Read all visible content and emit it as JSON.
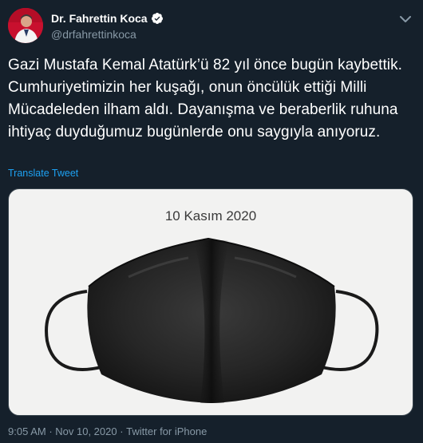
{
  "user": {
    "name": "Dr. Fahrettin Koca",
    "handle": "@drfahrettinkoca"
  },
  "tweet": {
    "text": "Gazi Mustafa Kemal Atatürk’ü 82 yıl önce bugün kaybettik. Cumhuriyetimizin her kuşağı, onun öncülük ettiği Milli Mücadeleden ilham aldı. Dayanışma ve beraberlik ruhuna ihtiyaç duyduğumuz bugünlerde onu saygıyla anıyoruz.",
    "translate_label": "Translate Tweet",
    "image_caption": "10 Kasım 2020"
  },
  "meta": {
    "time": "9:05 AM",
    "separator": " · ",
    "date": "Nov 10, 2020",
    "source": "Twitter for iPhone"
  },
  "colors": {
    "background": "#15202b",
    "link": "#1da1f2",
    "secondary_text": "#8899a6",
    "verified": "#1da1f2"
  },
  "icons": [
    "verified-badge-icon",
    "chevron-down-icon"
  ]
}
